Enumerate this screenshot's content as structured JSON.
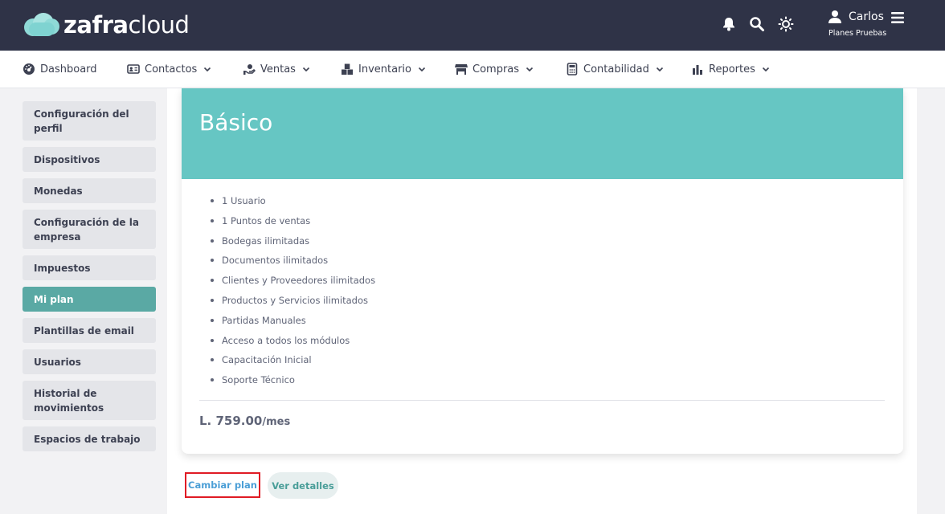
{
  "brand": {
    "part1": "zafra",
    "part2": "cloud"
  },
  "header": {
    "icons": [
      "bell-icon",
      "search-icon",
      "sun-icon",
      "user-icon",
      "menu-icon"
    ],
    "user_name": "Carlos",
    "user_company": "Planes Pruebas"
  },
  "nav": {
    "items": [
      {
        "label": "Dashboard",
        "icon": "dashboard-icon",
        "has_dropdown": false
      },
      {
        "label": "Contactos",
        "icon": "contact-card-icon",
        "has_dropdown": true
      },
      {
        "label": "Ventas",
        "icon": "sales-hand-icon",
        "has_dropdown": true
      },
      {
        "label": "Inventario",
        "icon": "boxes-icon",
        "has_dropdown": true
      },
      {
        "label": "Compras",
        "icon": "store-icon",
        "has_dropdown": true
      },
      {
        "label": "Contabilidad",
        "icon": "calculator-icon",
        "has_dropdown": true
      },
      {
        "label": "Reportes",
        "icon": "bar-chart-icon",
        "has_dropdown": true
      }
    ]
  },
  "sidebar": {
    "items": [
      {
        "label": "Configuración del perfil",
        "active": false
      },
      {
        "label": "Dispositivos",
        "active": false
      },
      {
        "label": "Monedas",
        "active": false
      },
      {
        "label": "Configuración de la empresa",
        "active": false
      },
      {
        "label": "Impuestos",
        "active": false
      },
      {
        "label": "Mi plan",
        "active": true
      },
      {
        "label": "Plantillas de email",
        "active": false
      },
      {
        "label": "Usuarios",
        "active": false
      },
      {
        "label": "Historial de movimientos",
        "active": false
      },
      {
        "label": "Espacios de trabajo",
        "active": false
      }
    ]
  },
  "plan": {
    "name": "Básico",
    "features": [
      "1 Usuario",
      "1 Puntos de ventas",
      "Bodegas ilimitadas",
      "Documentos ilimitados",
      "Clientes y Proveedores ilimitados",
      "Productos y Servicios ilimitados",
      "Partidas Manuales",
      "Acceso a todos los módulos",
      "Capacitación Inicial",
      "Soporte Técnico"
    ],
    "price": "L. 759.00",
    "period": "/mes"
  },
  "actions": {
    "change_plan": "Cambiar plan",
    "view_details": "Ver detalles"
  },
  "colors": {
    "header_bg": "#2f3347",
    "accent": "#66c6c3",
    "active_sidebar": "#5aa9a4",
    "highlight_border": "#e01b24",
    "link_blue": "#4a9ed6"
  }
}
